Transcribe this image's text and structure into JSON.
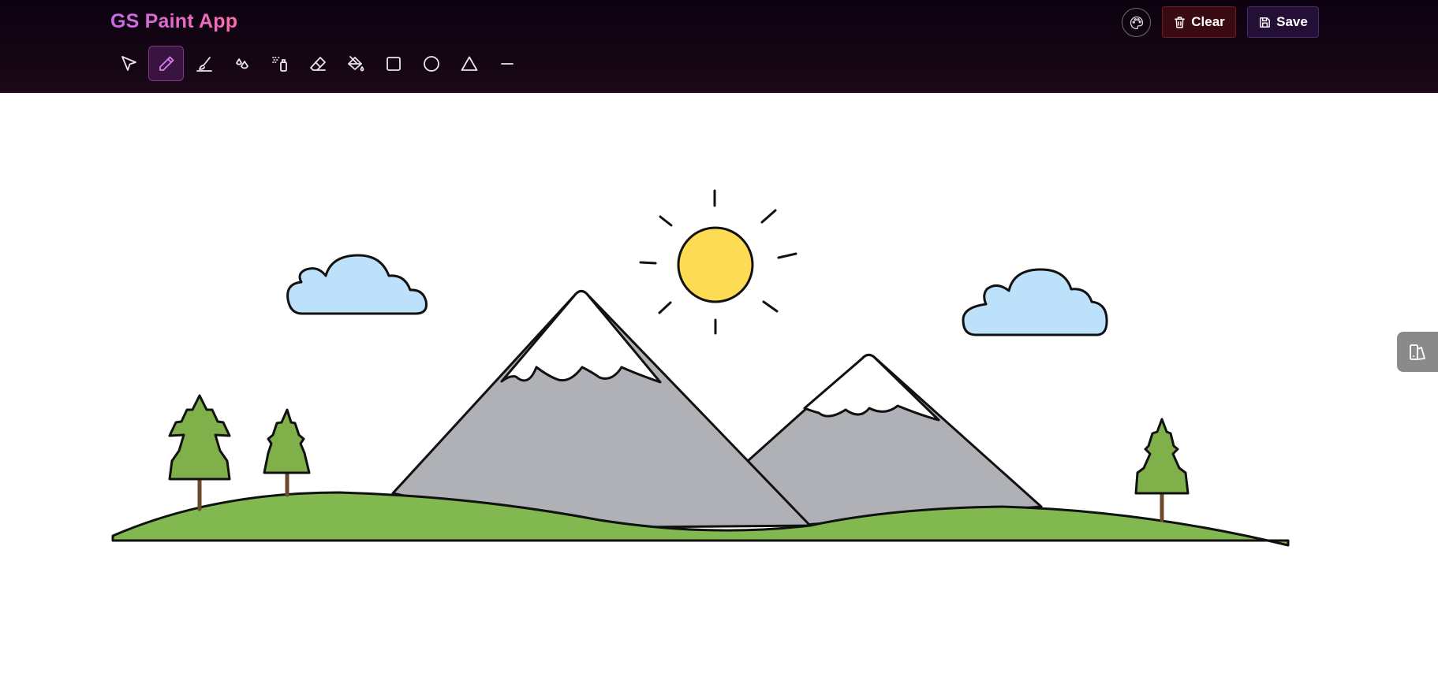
{
  "app": {
    "title": "GS Paint App"
  },
  "toolbar": {
    "tools": [
      {
        "name": "select",
        "icon": "cursor-arrow-icon",
        "active": false
      },
      {
        "name": "pencil",
        "icon": "pencil-icon",
        "active": true
      },
      {
        "name": "brush",
        "icon": "brush-icon",
        "active": false
      },
      {
        "name": "ink",
        "icon": "droplets-icon",
        "active": false
      },
      {
        "name": "spray",
        "icon": "spray-can-icon",
        "active": false
      },
      {
        "name": "eraser",
        "icon": "eraser-icon",
        "active": false
      },
      {
        "name": "fill",
        "icon": "paint-bucket-icon",
        "active": false
      },
      {
        "name": "rectangle",
        "icon": "square-icon",
        "active": false
      },
      {
        "name": "circle",
        "icon": "circle-icon",
        "active": false
      },
      {
        "name": "triangle",
        "icon": "triangle-icon",
        "active": false
      },
      {
        "name": "line",
        "icon": "minus-icon",
        "active": false
      }
    ],
    "clear_label": "Clear",
    "save_label": "Save",
    "palette_icon": "palette-icon"
  },
  "canvas": {
    "drawing": "landscape",
    "colors": {
      "sky": "#ffffff",
      "cloud": "#bde0fb",
      "sun": "#fddb52",
      "mountain": "#b0b1b6",
      "snow": "#ffffff",
      "grass": "#81b850",
      "tree": "#7fb04a",
      "trunk": "#6b4a2a",
      "outline": "#111111"
    }
  },
  "side_panel": {
    "icon": "layers-panel-icon"
  },
  "theme": {
    "accent": "#c86ae8",
    "topbar": "#12040f",
    "clear_bg": "#3a0a12",
    "save_bg": "#241036"
  }
}
